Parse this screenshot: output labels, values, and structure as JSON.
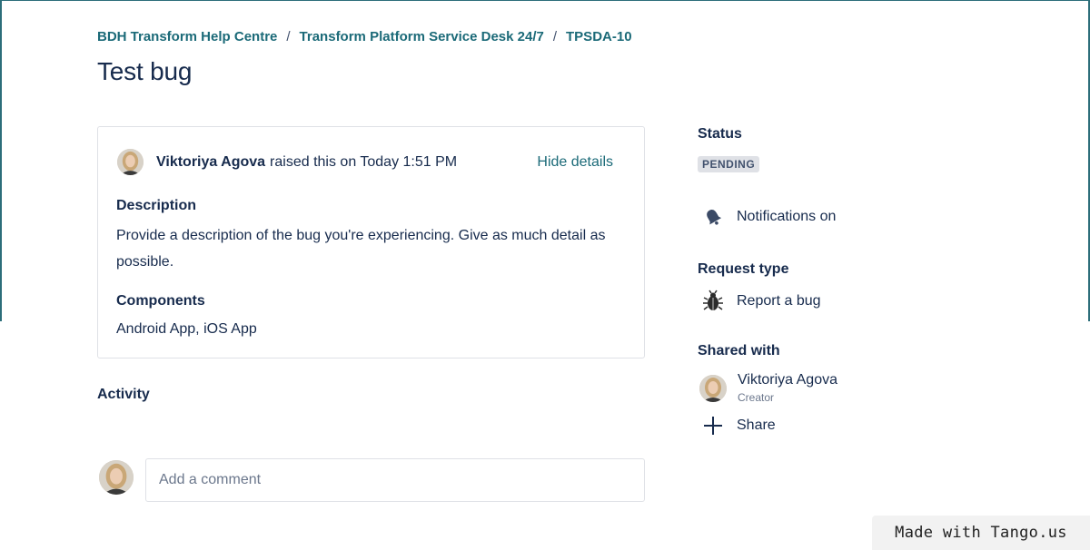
{
  "breadcrumb": {
    "items": [
      "BDH Transform Help Centre",
      "Transform Platform Service Desk 24/7",
      "TPSDA-10"
    ],
    "separator": "/"
  },
  "page_title": "Test bug",
  "request": {
    "author": "Viktoriya Agova",
    "raised_text": "raised this on Today 1:51 PM",
    "hide_details": "Hide details",
    "description_label": "Description",
    "description_value": "Provide a description of the bug you're experiencing. Give as much detail as possible.",
    "components_label": "Components",
    "components_value": "Android App, iOS App"
  },
  "activity": {
    "title": "Activity",
    "comment_placeholder": "Add a comment"
  },
  "sidebar": {
    "status_label": "Status",
    "status_value": "PENDING",
    "notifications": "Notifications on",
    "request_type_label": "Request type",
    "request_type_value": "Report a bug",
    "shared_with_label": "Shared with",
    "shared_user_name": "Viktoriya Agova",
    "shared_user_role": "Creator",
    "share_label": "Share"
  },
  "watermark": "Made with Tango.us",
  "colors": {
    "link": "#1b6a78",
    "text": "#172b4d",
    "lozenge_bg": "#dfe1e6",
    "frame": "#2c6e7a"
  }
}
